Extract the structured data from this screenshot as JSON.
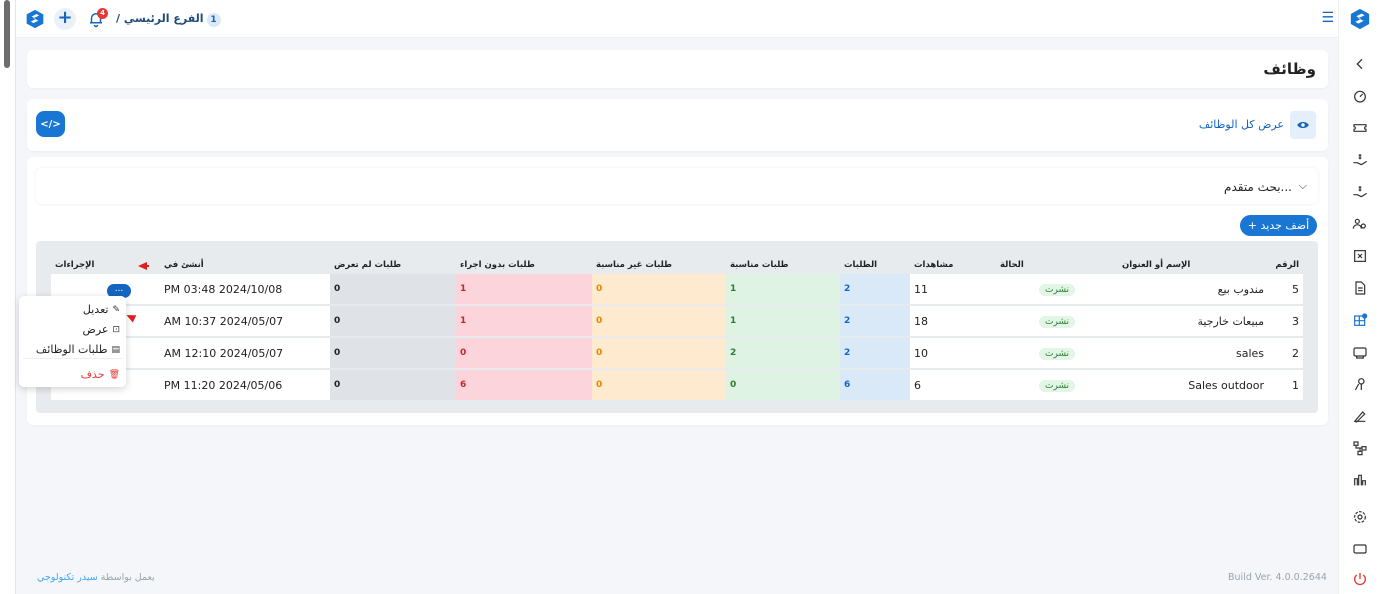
{
  "topbar": {
    "branch_label": "الفرع الرئيسي /",
    "branch_number": "1",
    "notification_count": "4"
  },
  "page": {
    "title": "وظائف"
  },
  "view_all": {
    "label": "عرض كل الوظائف"
  },
  "search": {
    "label": "بحث متقدم..."
  },
  "add_button": {
    "label": "+ أضف جديد"
  },
  "table": {
    "headers": {
      "number": "الرقم",
      "name": "الإسم أو العنوان",
      "status": "الحالة",
      "views": "مشاهدات",
      "requests": "الطلبات",
      "suitable": "طلبات مناسبة",
      "unsuitable": "طلبات غير مناسبة",
      "no_action": "طلبات بدون اجراء",
      "unseen": "طلبات لم تعرض",
      "created": "أنشئ في",
      "actions": "الإجراءات"
    },
    "rows": [
      {
        "number": "5",
        "name": "مندوب بيع",
        "status": "نشرت",
        "views": "11",
        "requests": "2",
        "suitable": "1",
        "unsuitable": "0",
        "no_action": "1",
        "unseen": "0",
        "created": "2024/10/08 03:48 PM"
      },
      {
        "number": "3",
        "name": "مبيعات خارجية",
        "status": "نشرت",
        "views": "18",
        "requests": "2",
        "suitable": "1",
        "unsuitable": "0",
        "no_action": "1",
        "unseen": "0",
        "created": "2024/05/07 10:37 AM"
      },
      {
        "number": "2",
        "name": "sales",
        "status": "نشرت",
        "views": "10",
        "requests": "2",
        "suitable": "2",
        "unsuitable": "0",
        "no_action": "0",
        "unseen": "0",
        "created": "2024/05/07 12:10 AM"
      },
      {
        "number": "1",
        "name": "Sales outdoor",
        "status": "نشرت",
        "views": "6",
        "requests": "6",
        "suitable": "0",
        "unsuitable": "0",
        "no_action": "6",
        "unseen": "0",
        "created": "2024/05/06 11:20 PM"
      }
    ],
    "more_label": "..."
  },
  "menu": {
    "edit": "تعديل",
    "view": "عرض",
    "job_requests": "طلبات الوظائف",
    "delete": "حذف"
  },
  "footer": {
    "powered_prefix": "يعمل بواسطة",
    "brand": "سيدر تكنولوجي",
    "build": "Build Ver. 4.0.0.2644"
  },
  "colors": {
    "primary": "#1976d2",
    "requests_bg": "#d9e9f8",
    "suitable_bg": "#def3e3",
    "unsuitable_bg": "#fdeacf",
    "no_action_bg": "#fbd4dc",
    "unseen_bg": "#dfe3e8",
    "arrow": "#e02020"
  },
  "icons": {
    "sidebar": [
      "chevron-left-icon",
      "dashboard-icon",
      "ticket-icon",
      "money-hand-icon",
      "money-hand-icon",
      "users-gear-icon",
      "archive-icon",
      "document-icon",
      "jobs-icon",
      "id-card-icon",
      "badge-icon",
      "signature-icon",
      "hierarchy-icon",
      "chart-icon",
      "settings-icon",
      "monitor-icon",
      "power-icon"
    ]
  }
}
